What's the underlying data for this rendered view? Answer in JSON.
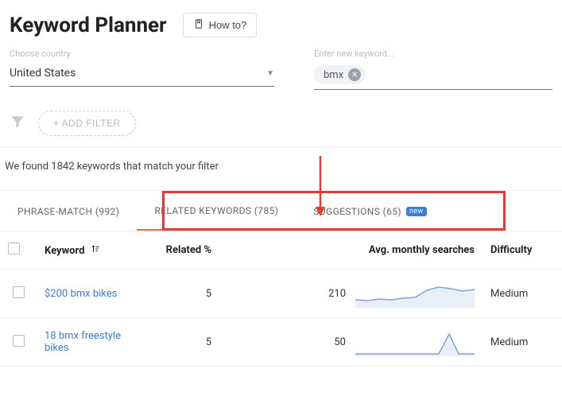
{
  "header": {
    "title": "Keyword Planner",
    "howto_label": "How to?"
  },
  "country": {
    "label": "Choose country",
    "value": "United States"
  },
  "keyword_input": {
    "label": "Enter new keyword...",
    "chip": "bmx"
  },
  "filter": {
    "add_label": "+ ADD FILTER"
  },
  "result_text": "We found 1842 keywords that match your filter",
  "tabs": {
    "phrase": "PHRASE-MATCH (992)",
    "related": "RELATED KEYWORDS (785)",
    "suggestions": "SUGGESTIONS (65)",
    "new_badge": "new"
  },
  "columns": {
    "keyword": "Keyword",
    "related": "Related %",
    "searches": "Avg. monthly searches",
    "difficulty": "Difficulty"
  },
  "rows": [
    {
      "keyword": "$200 bmx bikes",
      "related": "5",
      "searches": "210",
      "difficulty": "Medium",
      "spark": "0,26 15,27 30,25 45,26 60,24 75,23 90,14 105,10 120,12 135,15 150,13"
    },
    {
      "keyword": "18 bmx freestyle bikes",
      "related": "5",
      "searches": "50",
      "difficulty": "Medium",
      "spark": "0,33 15,33 30,33 45,33 60,33 75,33 90,33 105,33 118,8 130,33 150,33"
    }
  ]
}
